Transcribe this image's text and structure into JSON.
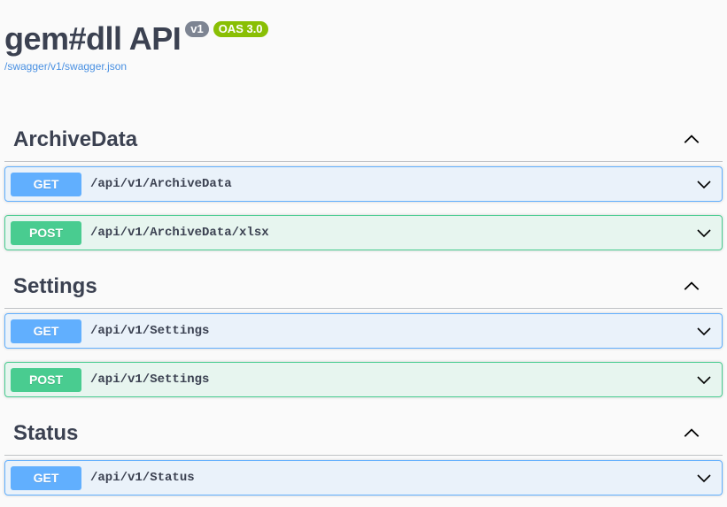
{
  "info": {
    "title": "gem#dll API",
    "version_badge": "v1",
    "oas_badge": "OAS 3.0",
    "spec_link": "/swagger/v1/swagger.json"
  },
  "tags": [
    {
      "name": "ArchiveData",
      "operations": [
        {
          "method": "GET",
          "path": "/api/v1/ArchiveData"
        },
        {
          "method": "POST",
          "path": "/api/v1/ArchiveData/xlsx"
        }
      ]
    },
    {
      "name": "Settings",
      "operations": [
        {
          "method": "GET",
          "path": "/api/v1/Settings"
        },
        {
          "method": "POST",
          "path": "/api/v1/Settings"
        }
      ]
    },
    {
      "name": "Status",
      "operations": [
        {
          "method": "GET",
          "path": "/api/v1/Status"
        }
      ]
    }
  ],
  "colors": {
    "get": "#61affe",
    "post": "#49cc90",
    "version_badge": "#7d8492",
    "oas_badge": "#89bf04",
    "link": "#4990e2"
  },
  "icons": {
    "tag_toggle": "chevron-up-icon",
    "operation_toggle": "chevron-down-icon"
  }
}
